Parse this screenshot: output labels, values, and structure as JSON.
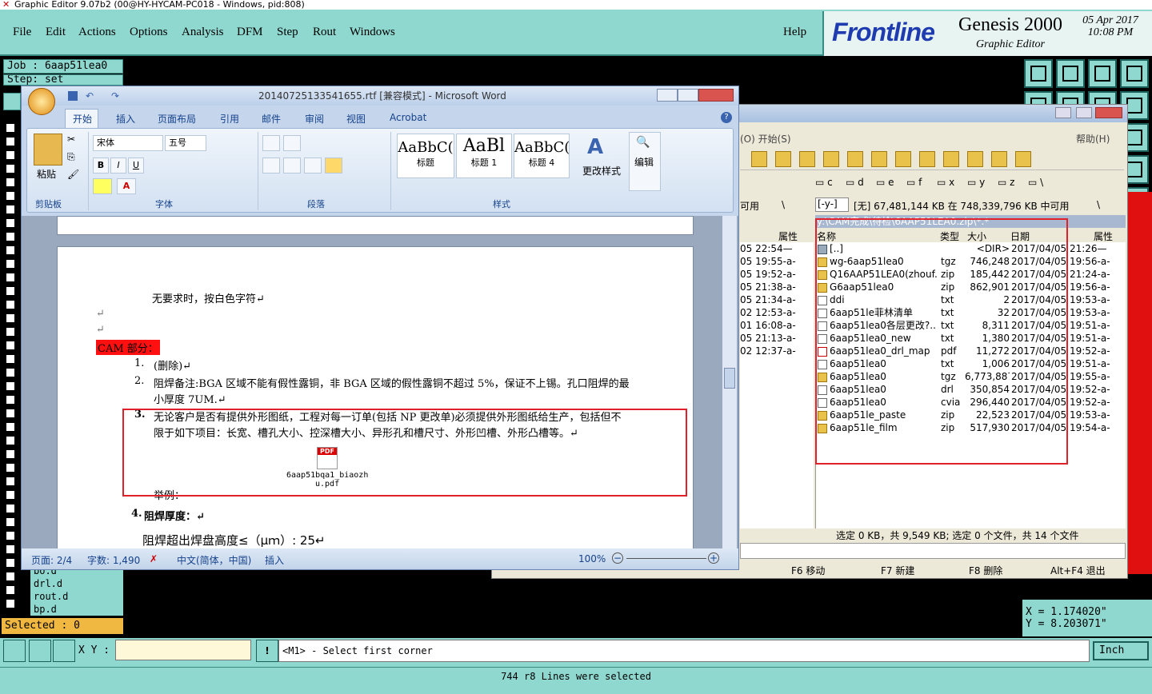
{
  "genesis": {
    "title": "Graphic Editor 9.07b2 (00@HY-HYCAM-PC018 - Windows, pid:808)",
    "menu": [
      "File",
      "Edit",
      "Actions",
      "Options",
      "Analysis",
      "DFM",
      "Step",
      "Rout",
      "Windows"
    ],
    "help": "Help",
    "brand": "Frontline",
    "product": "Genesis 2000",
    "subtitle": "Graphic Editor",
    "date": "05 Apr 2017",
    "time": "10:08 PM",
    "job": "Job : 6aap51lea0",
    "step": "Step: set",
    "layers": [
      "bo.d",
      "drl.d",
      "rout.d",
      "bp.d"
    ],
    "selected": "Selected : 0",
    "xy_label": "X Y :",
    "prompt": "<M1> - Select first corner",
    "status": "744 r8 Lines were selected",
    "coord_x": "X = 1.174020\"",
    "coord_y": "Y = 8.203071\"",
    "units": "Inch"
  },
  "word": {
    "title": "20140725133541655.rtf [兼容模式] - Microsoft Word",
    "tabs": [
      "开始",
      "插入",
      "页面布局",
      "引用",
      "邮件",
      "审阅",
      "视图",
      "Acrobat"
    ],
    "font_name": "宋体",
    "font_size": "五号",
    "groups": {
      "clipboard": "剪贴板",
      "font": "字体",
      "paragraph": "段落",
      "styles": "样式"
    },
    "paste": "粘贴",
    "styles": [
      {
        "preview": "AaBbC(",
        "name": "标题"
      },
      {
        "preview": "AaBl",
        "name": "标题 1"
      },
      {
        "preview": "AaBbC(",
        "name": "标题 4"
      }
    ],
    "change_styles": "更改样式",
    "edit": "编辑",
    "doc": {
      "line1": "无要求时，按白色字符↵",
      "cam_heading": "CAM 部分：",
      "item1": "(删除)↵",
      "item2a": "阻焊备注:BGA 区域不能有假性露铜，非 BGA 区域的假性露铜不超过 5%，保证不上锡。孔口阻焊的最",
      "item2b": "小厚度 7UM.↵",
      "item3a": "无论客户是否有提供外形图纸，工程对每一订单(包括 NP 更改单)必须提供外形图纸给生产，包括但不",
      "item3b": "限于如下项目：长宽、槽孔大小、控深槽大小、异形孔和槽尺寸、外形凹槽、外形凸槽等。↵",
      "attachment": "6aap51bqa1_biaozh",
      "attachment2": "u.pdf",
      "example": "举例：",
      "item4": "阻焊厚度：↵",
      "item4b": "阻焊超出焊盘高度≤（μｍ）: 25↵"
    },
    "status": {
      "page": "页面: 2/4",
      "words": "字数: 1,490",
      "lang": "中文(简体，中国)",
      "mode": "插入",
      "zoom": "100%"
    }
  },
  "filemanager": {
    "menu_left": "(O)  开始(S)",
    "help": "帮助(H)",
    "drives": [
      "c",
      "d",
      "e",
      "f",
      "x",
      "y",
      "z",
      "\\"
    ],
    "free_left": "可用",
    "drive_sel": "[-y-]",
    "free_right": "[无] 67,481,144 KB 在 748,339,796 KB 中可用",
    "path": "y:\\CAM完成\\待检\\6AAP51LEA0.zip\\*.*",
    "headers": {
      "name": "名称",
      "type": "类型",
      "size": "大小",
      "date": "日期",
      "attr": "属性"
    },
    "left_dates": [
      "05 22:54—",
      "05 19:55-a-",
      "05 19:52-a-",
      "05 21:38-a-",
      "05 21:34-a-",
      "02 12:53-a-",
      "01 16:08-a-",
      "05 21:13-a-",
      "02 12:37-a-"
    ],
    "files": [
      {
        "name": "[..]",
        "type": "",
        "size": "<DIR>",
        "date": "2017/04/05 21:26—",
        "icon": "up"
      },
      {
        "name": "wg-6aap51lea0",
        "type": "tgz",
        "size": "746,248",
        "date": "2017/04/05 19:56-a-",
        "icon": "zip"
      },
      {
        "name": "Q16AAP51LEA0(zhouf..",
        "type": "zip",
        "size": "185,442",
        "date": "2017/04/05 21:24-a-",
        "icon": "zip"
      },
      {
        "name": "G6aap51lea0",
        "type": "zip",
        "size": "862,901",
        "date": "2017/04/05 19:56-a-",
        "icon": "zip"
      },
      {
        "name": "ddi",
        "type": "txt",
        "size": "2",
        "date": "2017/04/05 19:53-a-",
        "icon": "txt"
      },
      {
        "name": "6aap51le菲林清单",
        "type": "txt",
        "size": "32",
        "date": "2017/04/05 19:53-a-",
        "icon": "txt"
      },
      {
        "name": "6aap51lea0各层更改?..",
        "type": "txt",
        "size": "8,311",
        "date": "2017/04/05 19:51-a-",
        "icon": "txt"
      },
      {
        "name": "6aap51lea0_new",
        "type": "txt",
        "size": "1,380",
        "date": "2017/04/05 19:51-a-",
        "icon": "txt"
      },
      {
        "name": "6aap51lea0_drl_map",
        "type": "pdf",
        "size": "11,272",
        "date": "2017/04/05 19:52-a-",
        "icon": "pdf"
      },
      {
        "name": "6aap51lea0",
        "type": "txt",
        "size": "1,006",
        "date": "2017/04/05 19:51-a-",
        "icon": "txt"
      },
      {
        "name": "6aap51lea0",
        "type": "tgz",
        "size": "6,773,887",
        "date": "2017/04/05 19:55-a-",
        "icon": "zip"
      },
      {
        "name": "6aap51lea0",
        "type": "drl",
        "size": "350,854",
        "date": "2017/04/05 19:52-a-",
        "icon": "txt"
      },
      {
        "name": "6aap51lea0",
        "type": "cvia",
        "size": "296,440",
        "date": "2017/04/05 19:52-a-",
        "icon": "txt"
      },
      {
        "name": "6aap51le_paste",
        "type": "zip",
        "size": "22,523",
        "date": "2017/04/05 19:53-a-",
        "icon": "zip"
      },
      {
        "name": "6aap51le_film",
        "type": "zip",
        "size": "517,930",
        "date": "2017/04/05 19:54-a-",
        "icon": "zip"
      }
    ],
    "status": "选定 0 KB，共 9,549 KB; 选定 0 个文件，共 14 个文件",
    "fkeys": [
      "F6 移动",
      "F7 新建",
      "F8 删除",
      "Alt+F4 退出"
    ]
  }
}
